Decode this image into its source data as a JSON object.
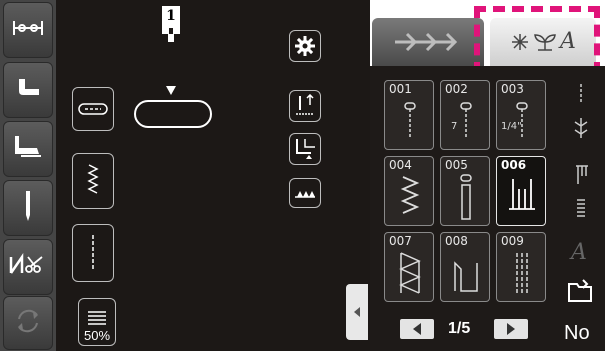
{
  "stitch_category_tabs": [
    {
      "name": "utility stitches",
      "selected": false
    },
    {
      "name": "decorative stitches",
      "selected": true,
      "text": "A"
    }
  ],
  "stitch_grid": {
    "page_indicator": "1/5",
    "stitches": [
      {
        "number": "001",
        "label": "",
        "selected": false
      },
      {
        "number": "002",
        "label": "7",
        "selected": false
      },
      {
        "number": "003",
        "label": "1/4\"",
        "selected": false
      },
      {
        "number": "004",
        "label": "",
        "selected": false
      },
      {
        "number": "005",
        "label": "",
        "selected": false
      },
      {
        "number": "006",
        "label": "",
        "selected": true
      },
      {
        "number": "007",
        "label": "",
        "selected": false
      },
      {
        "number": "008",
        "label": "",
        "selected": false
      },
      {
        "number": "009",
        "label": "",
        "selected": false
      }
    ]
  },
  "stitch_width_button": {
    "value": "50%"
  },
  "character_button": {
    "label": "A"
  },
  "no_button": {
    "label": "No"
  },
  "presser_foot": {
    "code": "1"
  },
  "highlight_color": "#e0147a"
}
